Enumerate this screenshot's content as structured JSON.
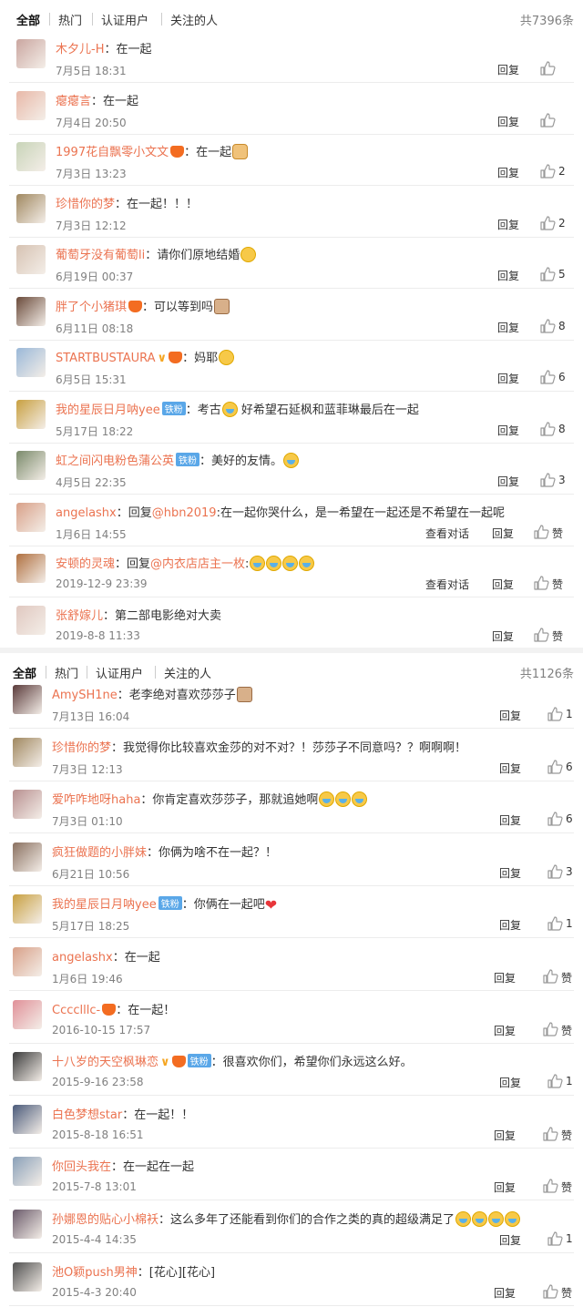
{
  "sections": [
    {
      "tabs": [
        "全部",
        "热门",
        "认证用户",
        "关注的人"
      ],
      "total": "共7396条",
      "comments": [
        {
          "user": "木夕儿-H",
          "text": "：在一起",
          "time": "7月5日 18:31",
          "reply": "回复",
          "likes": "",
          "avatar_color": "#caa6a0"
        },
        {
          "user": "瘪瘪言",
          "text": "：在一起",
          "time": "7月4日 20:50",
          "reply": "回复",
          "likes": "",
          "avatar_color": "#e8b8a8"
        },
        {
          "user": "1997花自飘零小文文",
          "badge": "crown",
          "text": "：在一起",
          "emoji": [
            "dog"
          ],
          "time": "7月3日 13:23",
          "reply": "回复",
          "likes": "2",
          "avatar_color": "#c8d4b8"
        },
        {
          "user": "珍惜你的梦",
          "text": "：在一起！！！",
          "time": "7月3日 12:12",
          "reply": "回复",
          "likes": "2",
          "avatar_color": "#a08860"
        },
        {
          "user": "葡萄牙没有葡萄li",
          "text": "：请你们原地结婚",
          "emoji": [
            "smile"
          ],
          "time": "6月19日 00:37",
          "reply": "回复",
          "likes": "5",
          "avatar_color": "#d6c2b2"
        },
        {
          "user": "胖了个小猪琪",
          "badge": "crown",
          "text": "：可以等到吗",
          "emoji": [
            "cat"
          ],
          "time": "6月11日 08:18",
          "reply": "回复",
          "likes": "8",
          "avatar_color": "#6a4a3a"
        },
        {
          "user": "STARTBUSTAURA",
          "badge": "v-crown",
          "text": "：妈耶",
          "emoji": [
            "smile"
          ],
          "time": "6月5日 15:31",
          "reply": "回复",
          "likes": "6",
          "avatar_color": "#9ab8d8"
        },
        {
          "user": "我的星辰日月呐yee",
          "badge": "fan",
          "fan_label": "铁粉",
          "text": "：考古",
          "emoji": [
            "cry"
          ],
          "text2": " 好希望石延枫和蓝菲琳最后在一起",
          "time": "5月17日 18:22",
          "reply": "回复",
          "likes": "8",
          "avatar_color": "#c8a040"
        },
        {
          "user": "虹之间闪电粉色蒲公英",
          "badge": "fan",
          "fan_label": "铁粉",
          "text": "：美好的友情。",
          "emoji": [
            "cry"
          ],
          "time": "4月5日 22:35",
          "reply": "回复",
          "likes": "3",
          "avatar_color": "#7a8a6a"
        },
        {
          "user": "angelashx",
          "text": "：回复",
          "mention": "@hbn2019",
          "text2": ":在一起你哭什么，是一希望在一起还是不希望在一起呢",
          "time": "1月6日 14:55",
          "view": "查看对话",
          "reply": "回复",
          "likes": "赞",
          "avatar_color": "#d8a088"
        },
        {
          "user": "安顿的灵魂",
          "text": "：回复",
          "mention": "@内衣店店主一枚",
          "text2": ":",
          "emoji": [
            "cry",
            "cry",
            "cry",
            "cry"
          ],
          "time": "2019-12-9 23:39",
          "view": "查看对话",
          "reply": "回复",
          "likes": "赞",
          "avatar_color": "#b07040"
        },
        {
          "user": "张舒嫁儿",
          "text": "：第二部电影绝对大卖",
          "time": "2019-8-8 11:33",
          "reply": "回复",
          "likes": "赞",
          "avatar_color": "#e0c8c0"
        }
      ]
    },
    {
      "tabs": [
        "全部",
        "热门",
        "认证用户",
        "关注的人"
      ],
      "total": "共1126条",
      "comments": [
        {
          "user": "AmySH1ne",
          "text": "：老李绝对喜欢莎莎子",
          "emoji": [
            "cat"
          ],
          "time": "7月13日 16:04",
          "reply": "回复",
          "likes": "1",
          "avatar_color": "#5a3a3a"
        },
        {
          "user": "珍惜你的梦",
          "text": "：我觉得你比较喜欢金莎的对不对？！莎莎子不同意吗？？啊啊啊！",
          "time": "7月3日 12:13",
          "reply": "回复",
          "likes": "6",
          "avatar_color": "#a08860"
        },
        {
          "user": "爱咋咋地呀haha",
          "text": "：你肯定喜欢莎莎子，那就追她啊",
          "emoji": [
            "cry",
            "cry",
            "cry"
          ],
          "time": "7月3日 01:10",
          "reply": "回复",
          "likes": "6",
          "avatar_color": "#b89090"
        },
        {
          "user": "疯狂做题的小胖妹",
          "text": "：你俩为啥不在一起？！",
          "time": "6月21日 10:56",
          "reply": "回复",
          "likes": "3",
          "avatar_color": "#8a7060"
        },
        {
          "user": "我的星辰日月呐yee",
          "badge": "fan",
          "fan_label": "铁粉",
          "text": "：你俩在一起吧",
          "heart": "❤",
          "time": "5月17日 18:25",
          "reply": "回复",
          "likes": "1",
          "avatar_color": "#c8a040"
        },
        {
          "user": "angelashx",
          "text": "：在一起",
          "time": "1月6日 19:46",
          "reply": "回复",
          "likes": "赞",
          "avatar_color": "#d8a088"
        },
        {
          "user": "Cccclllc-",
          "badge": "crown",
          "text": "：在一起！",
          "time": "2016-10-15 17:57",
          "reply": "回复",
          "likes": "赞",
          "avatar_color": "#e09098"
        },
        {
          "user": "十八岁的天空枫琳恋",
          "badge": "v-crown-fan",
          "fan_label": "铁粉",
          "text": "：很喜欢你们，希望你们永远这么好。",
          "time": "2015-9-16 23:58",
          "reply": "回复",
          "likes": "1",
          "avatar_color": "#3a3a3a"
        },
        {
          "user": "白色梦想star",
          "text": "：在一起！！",
          "time": "2015-8-18 16:51",
          "reply": "回复",
          "likes": "赞",
          "avatar_color": "#4a5a7a"
        },
        {
          "user": "你回头我在",
          "text": "：在一起在一起",
          "time": "2015-7-8 13:01",
          "reply": "回复",
          "likes": "赞",
          "avatar_color": "#8aa0b8"
        },
        {
          "user": "孙娜恩的贴心小棉袄",
          "text": "：这么多年了还能看到你们的合作之类的真的超级满足了",
          "emoji": [
            "cry",
            "cry",
            "cry",
            "cry"
          ],
          "time": "2015-4-4 14:35",
          "reply": "回复",
          "likes": "1",
          "avatar_color": "#6a5a6a"
        },
        {
          "user": "池O颖push男神",
          "text": "：[花心][花心]",
          "time": "2015-4-3 20:40",
          "reply": "回复",
          "likes": "赞",
          "avatar_color": "#505050"
        }
      ]
    }
  ]
}
